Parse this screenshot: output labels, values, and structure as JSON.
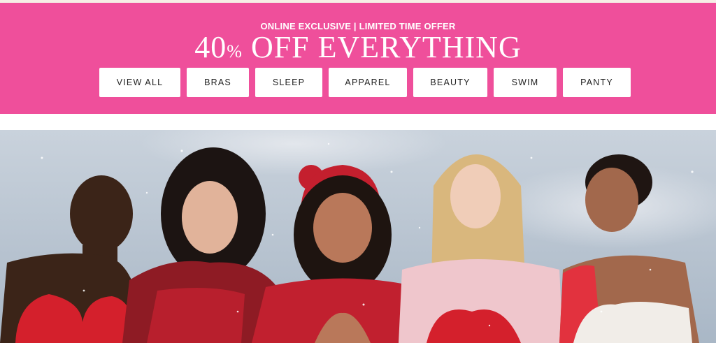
{
  "promo": {
    "eyebrow": "ONLINE EXCLUSIVE | LIMITED TIME OFFER",
    "headline_number": "40",
    "headline_percent": "%",
    "headline_text": " OFF EVERYTHING",
    "background_color": "#ef4f9b"
  },
  "categories": [
    {
      "label": "VIEW ALL"
    },
    {
      "label": "BRAS"
    },
    {
      "label": "SLEEP"
    },
    {
      "label": "APPAREL"
    },
    {
      "label": "BEAUTY"
    },
    {
      "label": "SWIM"
    },
    {
      "label": "PANTY"
    }
  ],
  "hero": {
    "description_icon": "photo-five-models-red-lingerie",
    "sky_color": "#b9c6d3",
    "accent_red": "#d4202c"
  }
}
